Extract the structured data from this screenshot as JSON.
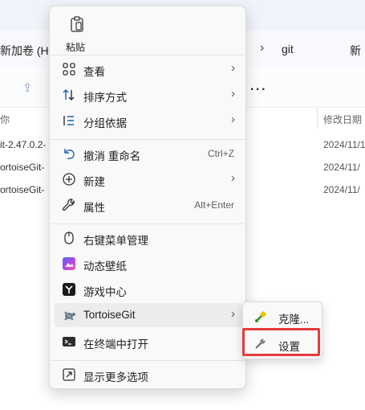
{
  "explorer": {
    "address_left": "新加卷 (H:",
    "address_folder": "git",
    "address_right": "新",
    "more_label": "...",
    "col_name": "你",
    "col_date": "修改日期",
    "files": [
      {
        "name": "it-2.47.0.2-",
        "date": "2024/11/1"
      },
      {
        "name": "ortoiseGit-",
        "date": "2024/11/"
      },
      {
        "name": "ortoiseGit-",
        "date": "2024/11/"
      }
    ]
  },
  "context_menu": {
    "paste_label": "粘贴",
    "items": [
      {
        "label": "查看",
        "icon": "grid-icon",
        "shortcut": "",
        "submenu": true
      },
      {
        "label": "排序方式",
        "icon": "sort-icon",
        "shortcut": "",
        "submenu": true
      },
      {
        "label": "分组依据",
        "icon": "group-icon",
        "shortcut": "",
        "submenu": true
      },
      {
        "label": "撤消 重命名",
        "icon": "undo-icon",
        "shortcut": "Ctrl+Z",
        "submenu": false
      },
      {
        "label": "新建",
        "icon": "new-icon",
        "shortcut": "",
        "submenu": true
      },
      {
        "label": "属性",
        "icon": "wrench-icon",
        "shortcut": "Alt+Enter",
        "submenu": false
      },
      {
        "label": "右键菜单管理",
        "icon": "mouse-icon",
        "shortcut": "",
        "submenu": false
      },
      {
        "label": "动态壁纸",
        "icon": "wallpaper-icon",
        "shortcut": "",
        "submenu": false
      },
      {
        "label": "游戏中心",
        "icon": "game-center-icon",
        "shortcut": "",
        "submenu": false
      },
      {
        "label": "TortoiseGit",
        "icon": "tortoisegit-icon",
        "shortcut": "",
        "submenu": true
      },
      {
        "label": "在终端中打开",
        "icon": "terminal-icon",
        "shortcut": "",
        "submenu": false
      },
      {
        "label": "显示更多选项",
        "icon": "more-options-icon",
        "shortcut": "",
        "submenu": false
      }
    ]
  },
  "submenu": {
    "items": [
      {
        "label": "克隆...",
        "icon": "clone-icon"
      },
      {
        "label": "设置",
        "icon": "settings-wrench-icon"
      }
    ]
  },
  "colors": {
    "highlight_border": "#e53b3b",
    "menu_bg": "#f9f9f9"
  }
}
